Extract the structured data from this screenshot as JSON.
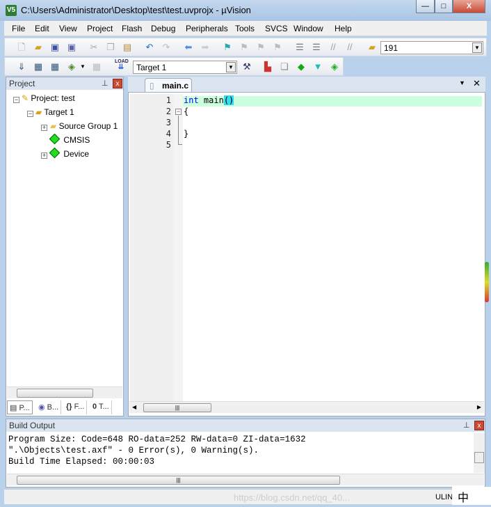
{
  "window": {
    "title": "C:\\Users\\Administrator\\Desktop\\test\\test.uvprojx - µVision",
    "app_icon": "V5",
    "minimize": "—",
    "maximize": "□",
    "close": "X"
  },
  "menu": [
    "File",
    "Edit",
    "View",
    "Project",
    "Flash",
    "Debug",
    "Peripherals",
    "Tools",
    "SVCS",
    "Window",
    "Help"
  ],
  "toolbar1": {
    "find_combo_value": "191",
    "icons": [
      "new-file",
      "open-file",
      "save",
      "save-all",
      "cut",
      "copy",
      "paste",
      "undo",
      "redo",
      "navigate-back",
      "navigate-forward",
      "bookmark",
      "prev-bookmark",
      "next-bookmark",
      "clear-bookmarks",
      "indent",
      "unindent",
      "comment",
      "uncomment",
      "find-in-files"
    ]
  },
  "toolbar2": {
    "target_value": "Target 1",
    "load_label": "LOAD",
    "icons": [
      "translate",
      "build",
      "rebuild",
      "batch-build",
      "stop-build",
      "download",
      "target-options",
      "manage-components",
      "file-extensions",
      "select-pack",
      "pack-installer",
      "components"
    ]
  },
  "project_panel": {
    "title": "Project",
    "pin": "⊥",
    "close": "x",
    "tree": [
      {
        "label": "Project: test"
      },
      {
        "label": "Target 1"
      },
      {
        "label": "Source Group 1"
      },
      {
        "label": "CMSIS"
      },
      {
        "label": "Device"
      }
    ],
    "tabs": [
      "P...",
      "B...",
      "F...",
      "T..."
    ]
  },
  "editor": {
    "tab": "main.c",
    "lines": [
      {
        "n": "1",
        "keyword": "int",
        "text": " main",
        "paren": "()"
      },
      {
        "n": "2",
        "text": "{"
      },
      {
        "n": "3",
        "text": ""
      },
      {
        "n": "4",
        "text": "}"
      },
      {
        "n": "5",
        "text": ""
      }
    ],
    "highlight_color": "#ccffdd",
    "paren_highlight": "#33ddee"
  },
  "build_output": {
    "title": "Build Output",
    "lines": [
      "Program Size: Code=648 RO-data=252 RW-data=0 ZI-data=1632",
      "\".\\Objects\\test.axf\" - 0 Error(s), 0 Warning(s).",
      "Build Time Elapsed:  00:00:03"
    ]
  },
  "status_bar": {
    "text": "ULIN",
    "ime": "中",
    "watermark": "https://blog.csdn.net/qq_40..."
  }
}
